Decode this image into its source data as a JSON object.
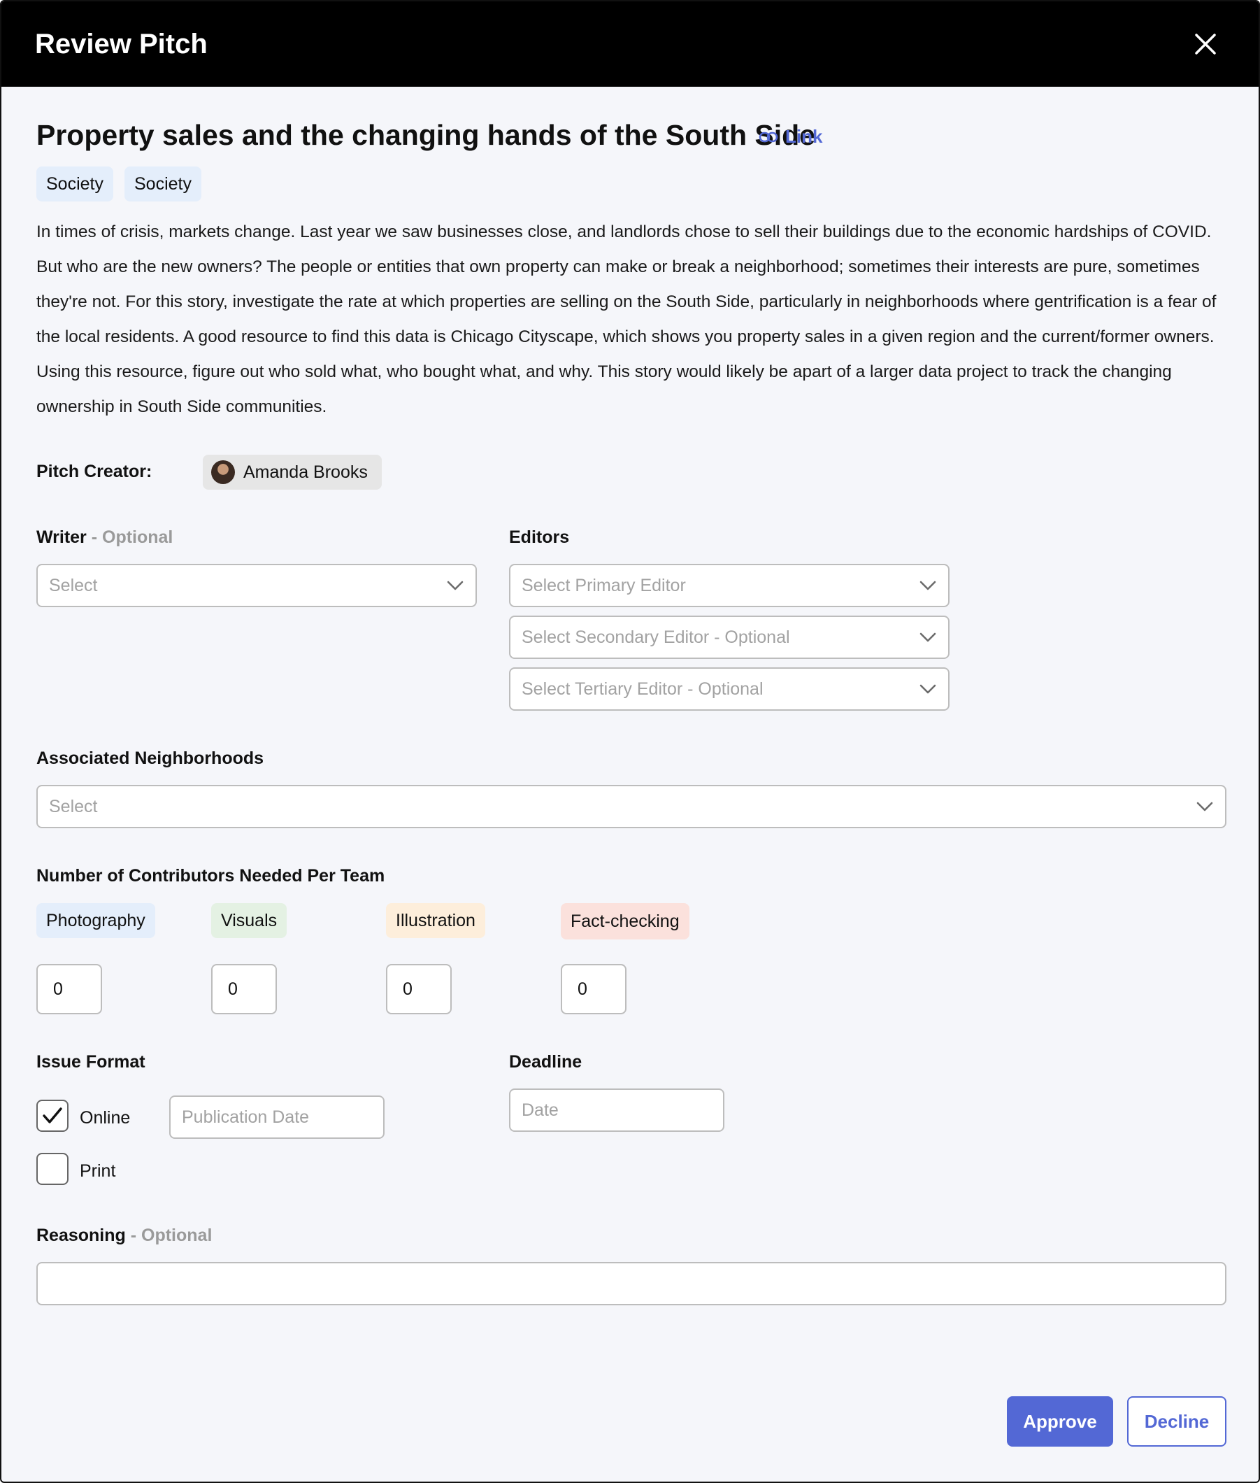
{
  "header": {
    "title": "Review Pitch"
  },
  "pitch": {
    "title": "Property sales and the changing hands of the South Side",
    "link_label": "Link",
    "tags": [
      "Society",
      "Society"
    ],
    "description": "In times of crisis, markets change. Last year we saw businesses close, and landlords chose to sell their buildings due to the economic hardships of COVID. But who are the new owners? The people or entities that own property can make or break a neighborhood; sometimes their interests are pure, sometimes they're not. For this story, investigate the rate at which properties are selling on the South Side, particularly in neighborhoods where gentrification is a fear of the local residents. A good resource to find this data is Chicago Cityscape, which shows you property sales in a given region and the current/former owners. Using this resource, figure out who sold what, who bought what, and why. This story would likely be apart of a larger data project to track the changing ownership in South Side communities."
  },
  "creator": {
    "label": "Pitch Creator:",
    "name": "Amanda Brooks"
  },
  "writer": {
    "label": "Writer",
    "optional": " - Optional",
    "placeholder": "Select"
  },
  "editors": {
    "label": "Editors",
    "primary": "Select Primary Editor",
    "secondary": "Select Secondary Editor - Optional",
    "tertiary": "Select Tertiary Editor - Optional"
  },
  "neighborhoods": {
    "label": "Associated Neighborhoods",
    "placeholder": "Select"
  },
  "contributors": {
    "label": "Number of Contributors Needed Per Team",
    "teams": [
      {
        "name": "Photography",
        "value": "0",
        "color": "#e4eefb"
      },
      {
        "name": "Visuals",
        "value": "0",
        "color": "#e4f1e3"
      },
      {
        "name": "Illustration",
        "value": "0",
        "color": "#fdeedb"
      },
      {
        "name": "Fact-checking",
        "value": "0",
        "color": "#fbe1dc"
      }
    ]
  },
  "issue_format": {
    "label": "Issue Format",
    "online_label": "Online",
    "online_checked": true,
    "print_label": "Print",
    "print_checked": false,
    "publication_placeholder": "Publication Date"
  },
  "deadline": {
    "label": "Deadline",
    "placeholder": "Date"
  },
  "reasoning": {
    "label": "Reasoning",
    "optional": " - Optional",
    "value": ""
  },
  "actions": {
    "approve": "Approve",
    "decline": "Decline"
  },
  "colors": {
    "accent": "#5368d5",
    "header_bg": "#000000",
    "body_bg": "#f5f6fa"
  }
}
